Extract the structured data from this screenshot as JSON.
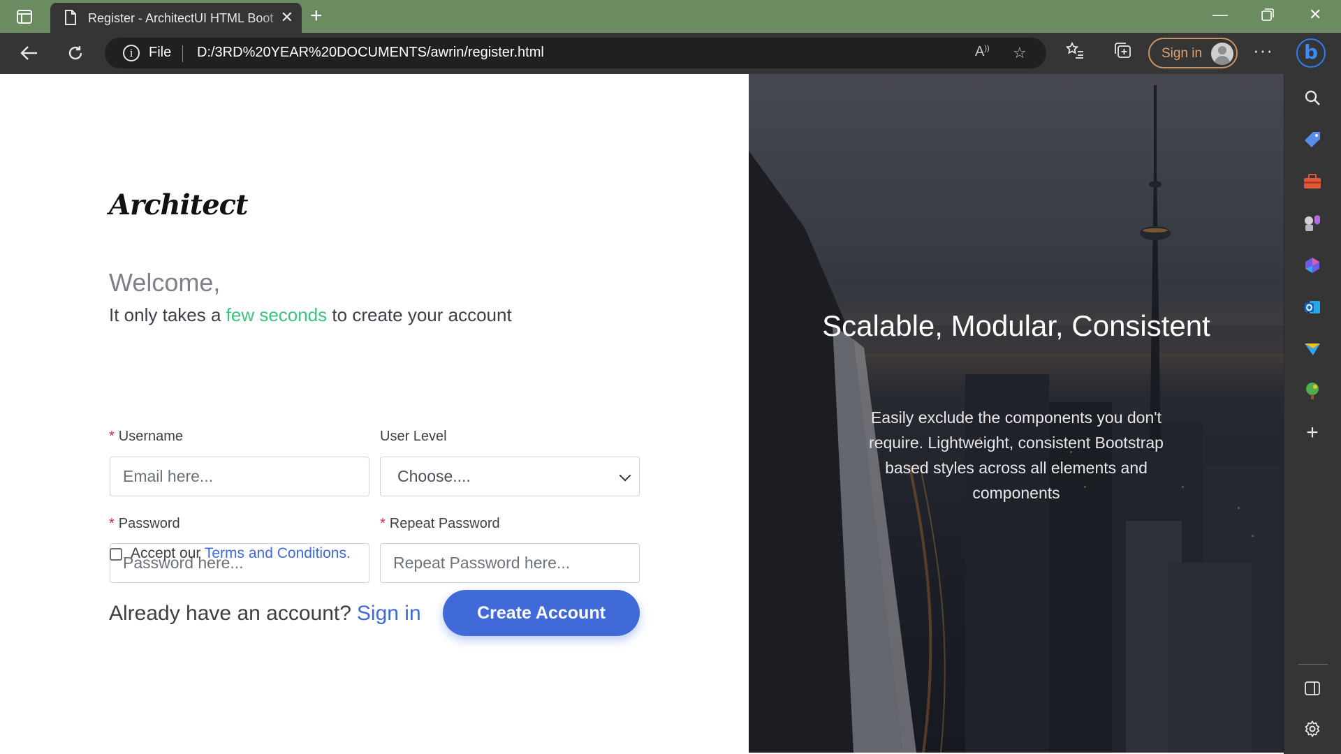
{
  "browser": {
    "tab_title": "Register - ArchitectUI HTML Boot",
    "address_prefix": "File",
    "url": "D:/3RD%20YEAR%20DOCUMENTS/awrin/register.html",
    "signin_label": "Sign in"
  },
  "page": {
    "logo": "Architect",
    "welcome": "Welcome,",
    "tagline_before": "It only takes a",
    "tagline_accent": "few seconds",
    "tagline_after": "to create your account",
    "form": {
      "username_label": "Username",
      "username_placeholder": "Email here...",
      "user_level_label": "User Level",
      "user_level_value": "Choose....",
      "password_label": "Password",
      "password_placeholder": "Password here...",
      "repeat_password_label": "Repeat Password",
      "repeat_password_placeholder": "Repeat Password here...",
      "terms_prefix": "Accept our",
      "terms_link": "Terms and Conditions",
      "terms_suffix": ".",
      "already_text": "Already have an account?",
      "signin_link": "Sign in",
      "create_button": "Create Account"
    },
    "hero": {
      "title": "Scalable, Modular, Consistent",
      "description": "Easily exclude the components you don't require. Lightweight, consistent Bootstrap based styles across all elements and components"
    }
  },
  "colors": {
    "primary": "#3f6ad8",
    "success_accent": "#3ac47d",
    "required": "#d92550",
    "titlebar": "#6b8c61"
  },
  "icons": {
    "sidebar": [
      "search-icon",
      "tag-icon",
      "toolbox-icon",
      "games-icon",
      "copilot-icon",
      "outlook-icon",
      "send-icon",
      "tree-icon",
      "add-icon",
      "split-screen-icon",
      "settings-icon"
    ]
  }
}
